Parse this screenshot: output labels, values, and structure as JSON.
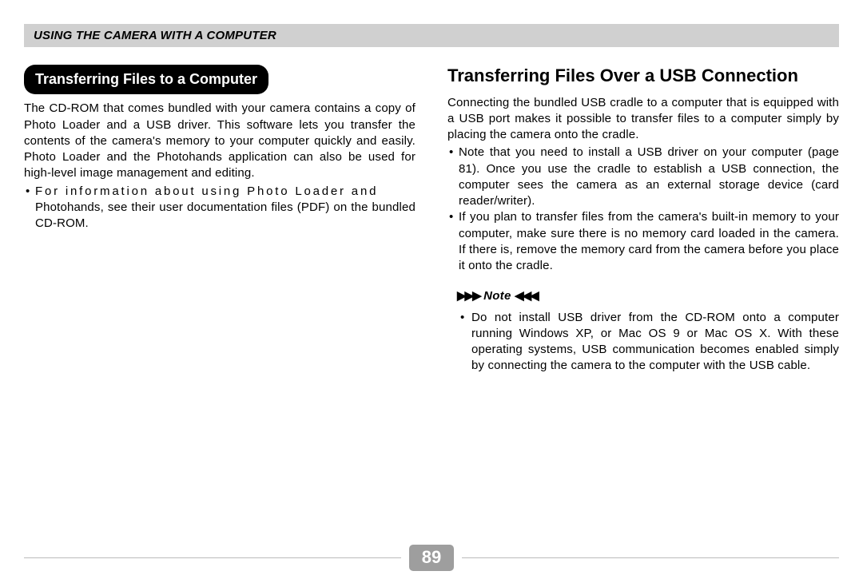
{
  "header": {
    "title": "USING THE CAMERA WITH A COMPUTER"
  },
  "left": {
    "heading": "Transferring Files to a Computer",
    "para1": "The CD-ROM that comes bundled with your camera contains a copy of Photo Loader and a USB driver. This software lets you transfer the contents of the camera's memory to your computer quickly and easily.  Photo Loader and the Photohands application can also be used for high-level image management and editing.",
    "bullet1a": "For information about using Photo Loader and",
    "bullet1b": "Photohands, see their user documentation files (PDF) on the bundled CD-ROM."
  },
  "right": {
    "heading": "Transferring Files Over a USB Connection",
    "para1": "Connecting the bundled USB cradle to a computer that is equipped with a USB port makes it possible to transfer files to a computer simply by placing the camera onto the cradle.",
    "bullet1": "Note that you need to install a USB driver on your computer (page 81). Once you use the cradle to establish a USB connection, the computer sees the camera as an external storage device (card reader/writer).",
    "bullet2": "If you plan to transfer files from the camera's built-in memory to your computer, make sure there is no memory card loaded in the camera. If there is, remove the memory card from the camera before you place it onto the cradle.",
    "note_label": "Note",
    "note_bullet": "Do not install USB driver from the CD-ROM onto a computer running Windows XP, or Mac OS 9 or Mac OS X. With these operating systems, USB communication becomes enabled simply by connecting the camera to the computer with the USB cable."
  },
  "footer": {
    "page": "89"
  }
}
